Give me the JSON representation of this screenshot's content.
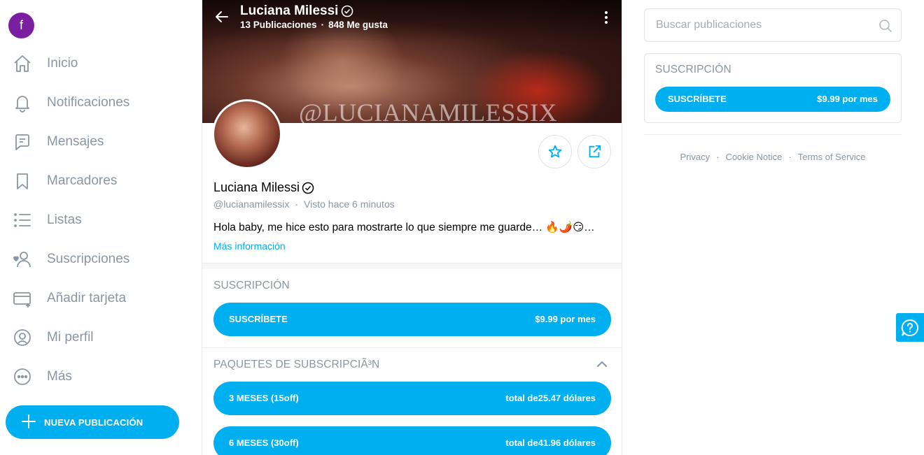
{
  "user": {
    "avatar_letter": "f"
  },
  "sidebar": {
    "items": [
      {
        "label": "Inicio",
        "icon": "home-icon"
      },
      {
        "label": "Notificaciones",
        "icon": "bell-icon"
      },
      {
        "label": "Mensajes",
        "icon": "message-icon"
      },
      {
        "label": "Marcadores",
        "icon": "bookmark-icon"
      },
      {
        "label": "Listas",
        "icon": "list-icon"
      },
      {
        "label": "Suscripciones",
        "icon": "subscriptions-icon"
      },
      {
        "label": "Añadir tarjeta",
        "icon": "card-icon"
      },
      {
        "label": "Mi perfil",
        "icon": "profile-icon"
      },
      {
        "label": "Más",
        "icon": "more-icon"
      }
    ],
    "new_post_label": "NUEVA PUBLICACIÓN"
  },
  "profile": {
    "name": "Luciana Milessi",
    "posts": "13 Publicaciones",
    "likes": "848 Me gusta",
    "watermark": "@LUCIANAMILESSIX",
    "handle": "@lucianamilessix",
    "last_seen": "Visto hace 6 minutos",
    "bio": "Hola baby, me hice esto para mostrarte lo que siempre me guarde… 🔥🌶️😏…",
    "more_info": "Más información"
  },
  "subscription": {
    "title": "SUSCRIPCIÓN",
    "button_label": "SUSCRÍBETE",
    "price": "$9.99 por mes"
  },
  "bundles": {
    "title": "PAQUETES DE SUBSCRIPCIÃ³N",
    "items": [
      {
        "label": "3 MESES (15off)",
        "total": "total de25.47 dólares"
      },
      {
        "label": "6 MESES (30off)",
        "total": "total de41.96 dólares"
      }
    ]
  },
  "right": {
    "search_placeholder": "Buscar publicaciones",
    "subscription_title": "SUSCRIPCIÓN",
    "subscription_button": "SUSCRÍBETE",
    "subscription_price": "$9.99 por mes",
    "footer": [
      "Privacy",
      "Cookie Notice",
      "Terms of Service"
    ],
    "separator": "·"
  },
  "colors": {
    "accent": "#00aff0",
    "muted": "#8a96a3",
    "avatar": "#7b1fa2"
  }
}
